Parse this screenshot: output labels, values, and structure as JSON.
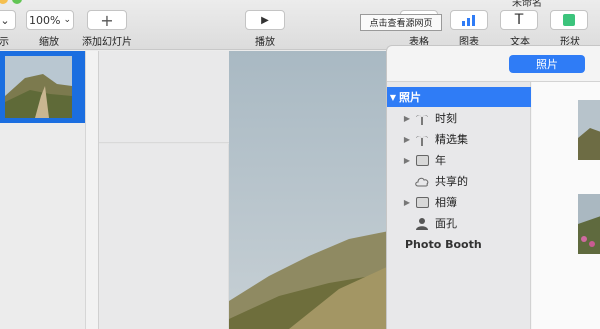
{
  "toolbar": {
    "view_label": "示",
    "zoom_value": "100%",
    "zoom_label": "缩放",
    "add_slide_label": "添加幻灯片",
    "play_label": "播放",
    "table_label": "表格",
    "chart_label": "图表",
    "text_label": "文本",
    "shape_label": "形状",
    "doc_title": "未命名"
  },
  "tooltip": {
    "text": "点击查看源网页"
  },
  "media_browser": {
    "tab_photos": "照片",
    "sources": [
      {
        "label": "照片",
        "icon": "triangle-down",
        "selected": true
      },
      {
        "label": "时刻",
        "icon": "palm-tree-icon"
      },
      {
        "label": "精选集",
        "icon": "palm-tree-icon"
      },
      {
        "label": "年",
        "icon": "stack-icon"
      },
      {
        "label": "共享的",
        "icon": "cloud-icon"
      },
      {
        "label": "相簿",
        "icon": "album-icon"
      },
      {
        "label": "面孔",
        "icon": "person-icon"
      },
      {
        "label": "Photo Booth",
        "icon": ""
      }
    ]
  },
  "colors": {
    "accent": "#2f7cf6",
    "selection": "#1b6ee0"
  }
}
